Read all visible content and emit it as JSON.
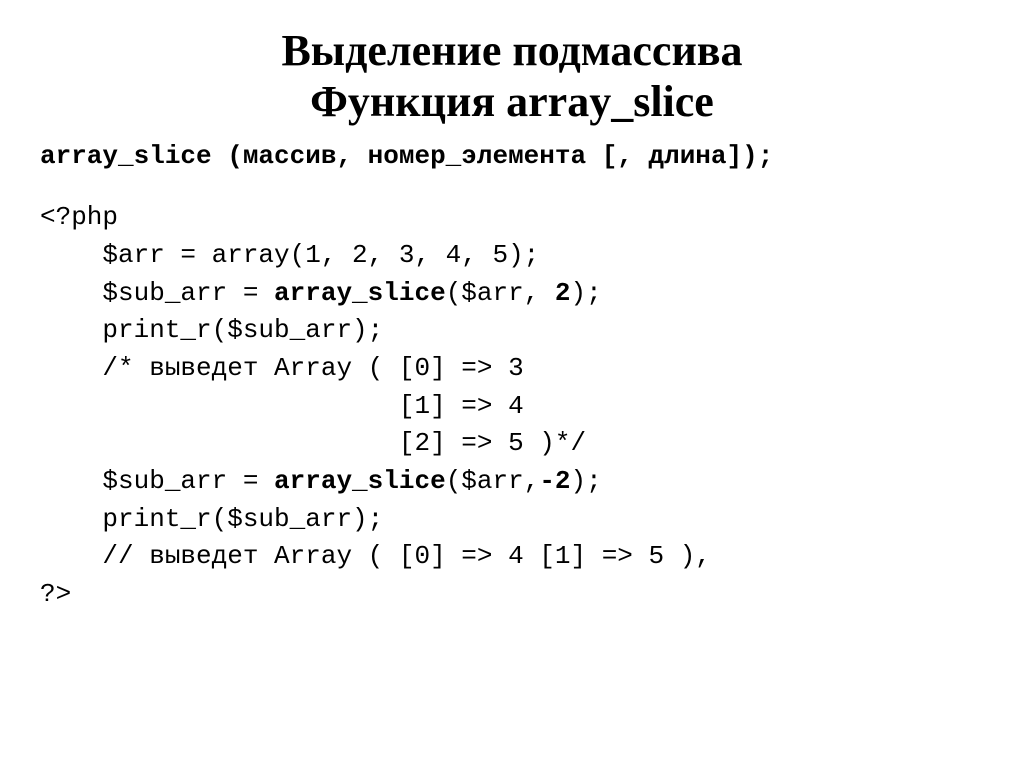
{
  "title_line1": "Выделение подмассива",
  "title_line2": "Функция array_slice",
  "syntax": "array_slice (массив, номер_элемента [, длина]);",
  "code": {
    "l1": "<?php",
    "l2": "    $arr = array(1, 2, 3, 4, 5);",
    "l3a": "    $sub_arr = ",
    "l3b": "array_slice",
    "l3c": "($arr, ",
    "l3d": "2",
    "l3e": ");",
    "l4": "    print_r($sub_arr);",
    "l5": "    /* выведет Array ( [0] => 3",
    "l6": "                       [1] => 4",
    "l7": "                       [2] => 5 )*/",
    "l8a": "    $sub_arr = ",
    "l8b": "array_slice",
    "l8c": "($arr,",
    "l8d": "-2",
    "l8e": ");",
    "l9": "    print_r($sub_arr);",
    "l10": "    // выведет Array ( [0] => 4 [1] => 5 ),",
    "l11": "?>"
  }
}
